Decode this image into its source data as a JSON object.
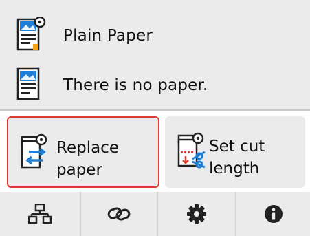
{
  "status": {
    "paper_type": {
      "icon": "paper-roll-icon",
      "text": "Plain Paper"
    },
    "paper_state": {
      "icon": "paper-sheet-icon",
      "text": "There is no paper."
    }
  },
  "buttons": {
    "replace_paper": {
      "icon": "replace-paper-icon",
      "line1": "Replace",
      "line2": "paper",
      "highlight_color": "#e03b2c"
    },
    "set_cut_length": {
      "icon": "set-cut-length-icon",
      "line1": "Set cut",
      "line2": "length"
    }
  },
  "nav": [
    {
      "icon": "network-icon"
    },
    {
      "icon": "link-icon"
    },
    {
      "icon": "settings-gear-icon"
    },
    {
      "icon": "info-icon"
    }
  ],
  "colors": {
    "panel": "#ebebeb",
    "accent": "#1e88e5",
    "highlight": "#e03b2c"
  }
}
